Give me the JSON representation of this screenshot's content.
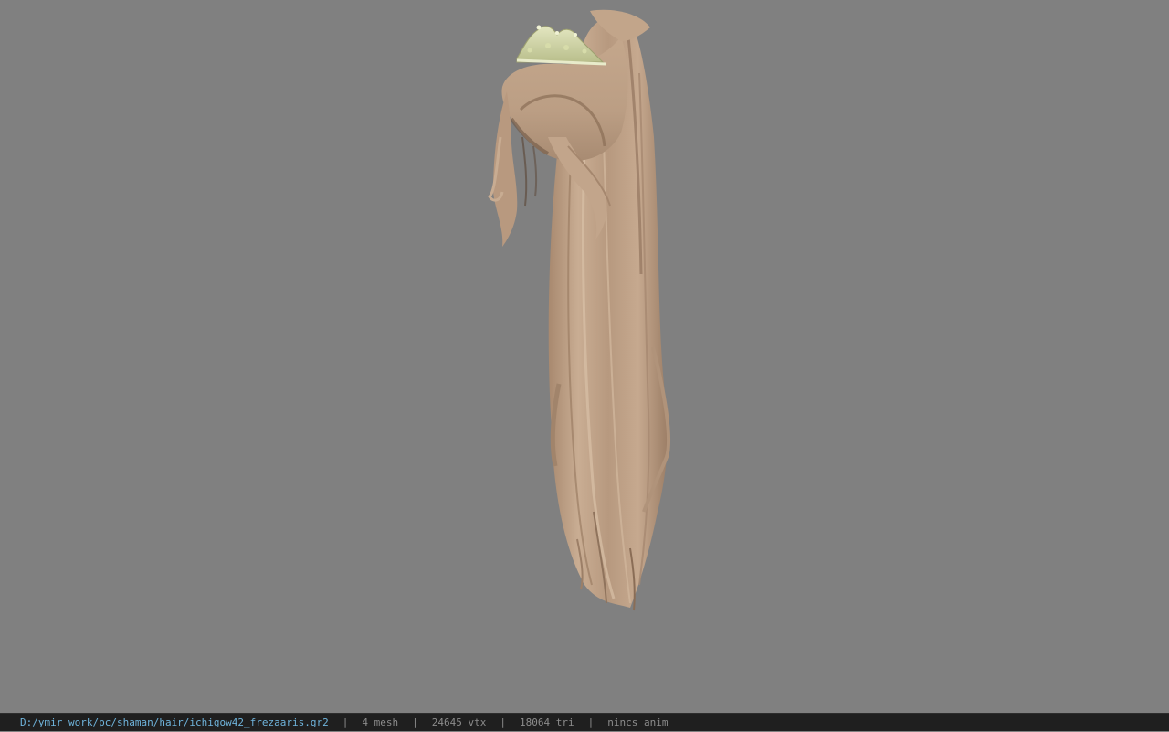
{
  "viewport": {
    "background_color": "#808080",
    "model_name": "hair-model",
    "tiara_name": "tiara"
  },
  "statusbar": {
    "path_color": "#6fb4dc",
    "text_color": "#8c8c8c",
    "file_path": "D:/ymir work/pc/shaman/hair/ichigow42_frezaaris.gr2",
    "separator": "|",
    "mesh_count": "4 mesh",
    "vertex_count": "24645 vtx",
    "triangle_count": "18064 tri",
    "anim_status": "nincs anim"
  }
}
